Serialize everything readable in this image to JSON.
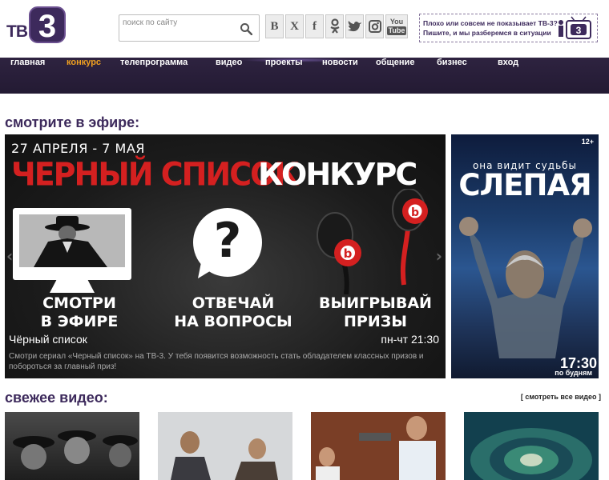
{
  "logo": {
    "prefix": "ТВ",
    "digit": "3"
  },
  "search": {
    "placeholder": "поиск по сайту"
  },
  "social": [
    {
      "icon": "vk-icon",
      "glyph": "В"
    },
    {
      "icon": "x-icon",
      "glyph": "X"
    },
    {
      "icon": "facebook-icon",
      "glyph": "f"
    },
    {
      "icon": "odnoklassniki-icon",
      "glyph": "ОК"
    },
    {
      "icon": "twitter-icon",
      "glyph": "t"
    },
    {
      "icon": "instagram-icon",
      "glyph": "◎"
    },
    {
      "icon": "youtube-icon",
      "glyph_top": "You",
      "glyph_bottom": "Tube"
    }
  ],
  "notice": {
    "line1": "Плохо или совсем не показывает ТВ-3?",
    "line2": "Пишите, и мы разберемся в ситуации"
  },
  "nav": {
    "items": [
      "главная",
      "конкурс",
      "телепрограмма",
      "видео",
      "проекты",
      "новости",
      "общение",
      "бизнес",
      "вход"
    ],
    "active_index": 1,
    "active_color": "#f0a020"
  },
  "on_air": {
    "title": "смотрите в эфире:",
    "main": {
      "dates": "27 АПРЕЛЯ - 7 МАЯ",
      "title_red": "ЧЕРНЫЙ СПИСОК",
      "title_white": "КОНКУРС",
      "steps": [
        {
          "line1": "СМОТРИ",
          "line2": "В ЭФИРЕ"
        },
        {
          "line1": "ОТВЕЧАЙ",
          "line2": "НА ВОПРОСЫ"
        },
        {
          "line1": "ВЫИГРЫВАЙ",
          "line2": "ПРИЗЫ"
        }
      ],
      "show_name": "Чёрный список",
      "schedule": "пн-чт 21:30",
      "description": "Смотри сериал «Черный список» на ТВ-3. У тебя появится возможность стать обладателем классных призов и побороться за главный приз!"
    },
    "side": {
      "age": "12+",
      "tagline": "она видит судьбы",
      "title": "СЛЕПАЯ",
      "time": "17:30",
      "days": "по будням"
    }
  },
  "fresh_video": {
    "title": "свежее видео:",
    "all_link": "[ смотреть все видео ]"
  },
  "colors": {
    "brand": "#3d2a5c",
    "nav_bg": "#2a1f3a",
    "accent_red": "#d42020"
  }
}
